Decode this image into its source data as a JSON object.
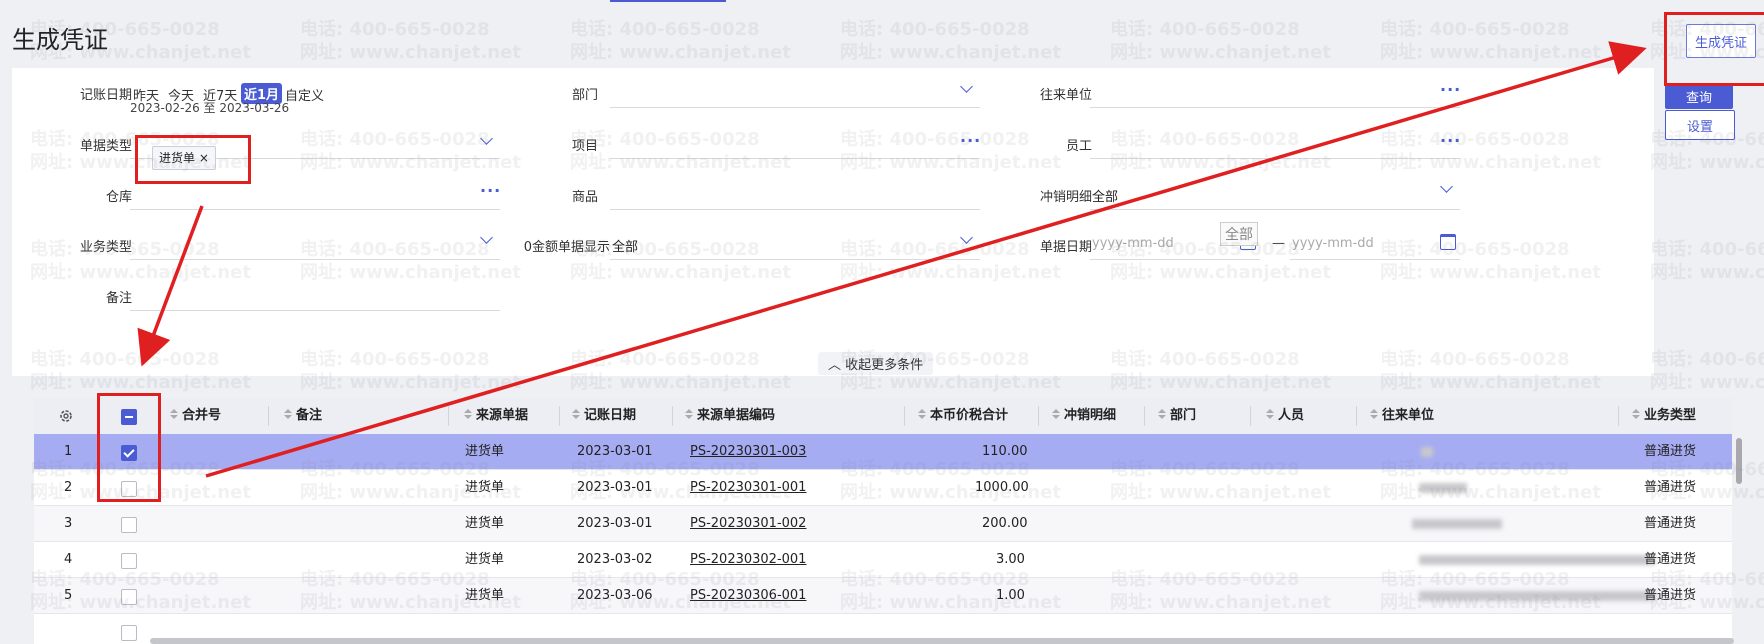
{
  "page": {
    "title": "生成凭证"
  },
  "actions": {
    "generate": "生成凭证",
    "query": "查询",
    "settings": "设置"
  },
  "watermark": {
    "phone": "电话: 400-665-0028",
    "site": "网址: www.chanjet.net"
  },
  "filters": {
    "date_label": "记账日期",
    "quick_dates": [
      "昨天",
      "今天",
      "近7天",
      "近1月",
      "自定义"
    ],
    "active_quick_date": "近1月",
    "date_range": "2023-02-26 至 2023-03-26",
    "doc_type_label": "单据类型",
    "doc_type_tag": "进货单",
    "doc_type_tag_remove": "×",
    "warehouse_label": "仓库",
    "biz_type_label": "业务类型",
    "remark_label": "备注",
    "dept_label": "部门",
    "project_label": "项目",
    "goods_label": "商品",
    "zero_amount_label": "0金额单据显示",
    "zero_amount_value": "全部",
    "partner_label": "往来单位",
    "employee_label": "员工",
    "writeoff_label": "冲销明细",
    "writeoff_value": "全部",
    "writeoff_tooltip": "全部",
    "bill_date_label": "单据日期",
    "bill_date_from_placeholder": "yyyy-mm-dd",
    "bill_date_sep": "—",
    "bill_date_to_placeholder": "yyyy-mm-dd",
    "collapse_label": "收起更多条件"
  },
  "icons": {
    "settings": "gear-icon",
    "dropdown": "chevron-down-icon",
    "more": "ellipsis-icon",
    "calendar": "calendar-icon",
    "collapse": "chevron-up-icon"
  },
  "table": {
    "columns": [
      "合并号",
      "备注",
      "来源单据",
      "记账日期",
      "来源单据编码",
      "本币价税合计",
      "冲销明细",
      "部门",
      "人员",
      "往来单位",
      "业务类型"
    ],
    "rows": [
      {
        "no": "1",
        "checked": true,
        "source": "进货单",
        "date": "2023-03-01",
        "code": "PS-20230301-003",
        "amount": "110.00",
        "biz": "普通进货"
      },
      {
        "no": "2",
        "checked": false,
        "source": "进货单",
        "date": "2023-03-01",
        "code": "PS-20230301-001",
        "amount": "1000.00",
        "biz": "普通进货"
      },
      {
        "no": "3",
        "checked": false,
        "source": "进货单",
        "date": "2023-03-01",
        "code": "PS-20230301-002",
        "amount": "200.00",
        "biz": "普通进货"
      },
      {
        "no": "4",
        "checked": false,
        "source": "进货单",
        "date": "2023-03-02",
        "code": "PS-20230302-001",
        "amount": "3.00",
        "biz": "普通进货"
      },
      {
        "no": "5",
        "checked": false,
        "source": "进货单",
        "date": "2023-03-06",
        "code": "PS-20230306-001",
        "amount": "1.00",
        "biz": "普通进货"
      }
    ]
  },
  "colors": {
    "accent": "#4a5bd4",
    "selected_row": "#a6acf2",
    "annotation": "#e02020"
  }
}
